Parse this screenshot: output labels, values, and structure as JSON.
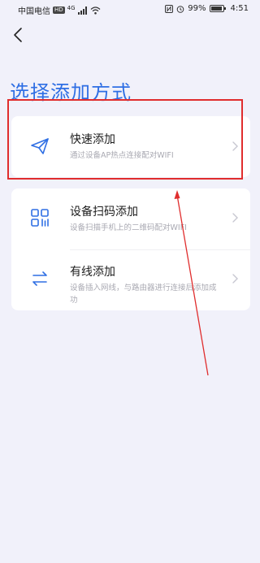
{
  "status_bar": {
    "carrier": "中国电信",
    "network_badge": "HD",
    "network_type": "4G",
    "icons": [
      "signal-icon",
      "wifi-icon",
      "nfc-icon",
      "alarm-icon",
      "battery-icon"
    ],
    "battery_percent": "99%",
    "time": "4:51"
  },
  "header": {
    "back_icon": "chevron-left-icon",
    "title": "选择添加方式"
  },
  "options": [
    {
      "icon": "paper-plane-icon",
      "title": "快速添加",
      "description": "通过设备AP热点连接配对WIFI"
    },
    {
      "icon": "qr-code-icon",
      "title": "设备扫码添加",
      "description": "设备扫描手机上的二维码配对WIFI"
    },
    {
      "icon": "swap-arrows-icon",
      "title": "有线添加",
      "description": "设备插入网线，与路由器进行连接后添加成功"
    }
  ],
  "colors": {
    "accent": "#2f6fe4",
    "background": "#f1f1fa",
    "highlight": "#e02d2d"
  }
}
